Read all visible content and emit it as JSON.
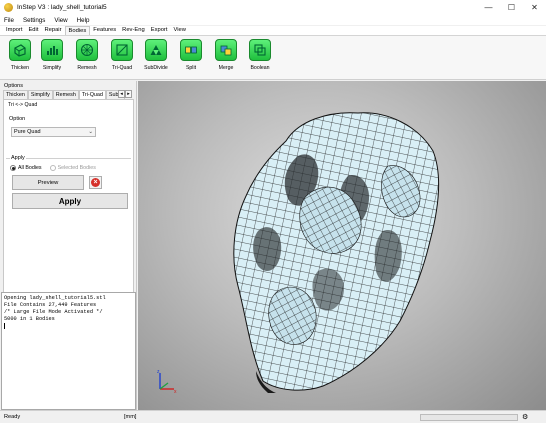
{
  "window": {
    "title": "InStep V3 : lady_shell_tutorial5"
  },
  "menu": [
    "File",
    "Settings",
    "View",
    "Help"
  ],
  "ribbon_tabs": [
    {
      "label": "Import"
    },
    {
      "label": "Edit"
    },
    {
      "label": "Repair"
    },
    {
      "label": "Bodies",
      "active": true
    },
    {
      "label": "Features"
    },
    {
      "label": "Rev-Eng"
    },
    {
      "label": "Export"
    },
    {
      "label": "View"
    }
  ],
  "tools": [
    {
      "label": "Thicken",
      "icon": "thicken-icon"
    },
    {
      "label": "Simplify",
      "icon": "simplify-icon"
    },
    {
      "label": "Remesh",
      "icon": "remesh-icon"
    },
    {
      "label": "Tri-Quad",
      "icon": "tri-quad-icon"
    },
    {
      "label": "SubDivide",
      "icon": "subdivide-icon"
    },
    {
      "label": "Split",
      "icon": "split-icon"
    },
    {
      "label": "Merge",
      "icon": "merge-icon"
    },
    {
      "label": "Boolean",
      "icon": "boolean-icon"
    }
  ],
  "options": {
    "header": "Options",
    "tabs": [
      "Thicken",
      "Simplify",
      "Remesh",
      "Tri-Quad",
      "SubD"
    ],
    "active_tab": "Tri-Quad",
    "subtitle": "Tri <-> Quad",
    "option_label": "Option",
    "option_value": "Pure Quad",
    "apply_label": "Apply",
    "all_bodies": "All Bodies",
    "selected_bodies": "Selected Bodies",
    "preview_label": "Preview",
    "apply_button": "Apply"
  },
  "console": [
    "Opening lady_shell_tutorial5.stl",
    "File Contains 27,449 Features",
    "/* Large File Mode Activated */",
    "5000 in 1 Bodies"
  ],
  "status": {
    "ready": "Ready",
    "units": "[mm]"
  },
  "colors": {
    "accent_green": "#2fd14d",
    "mesh_fill": "#d7eef5",
    "mesh_edge": "#222222"
  }
}
